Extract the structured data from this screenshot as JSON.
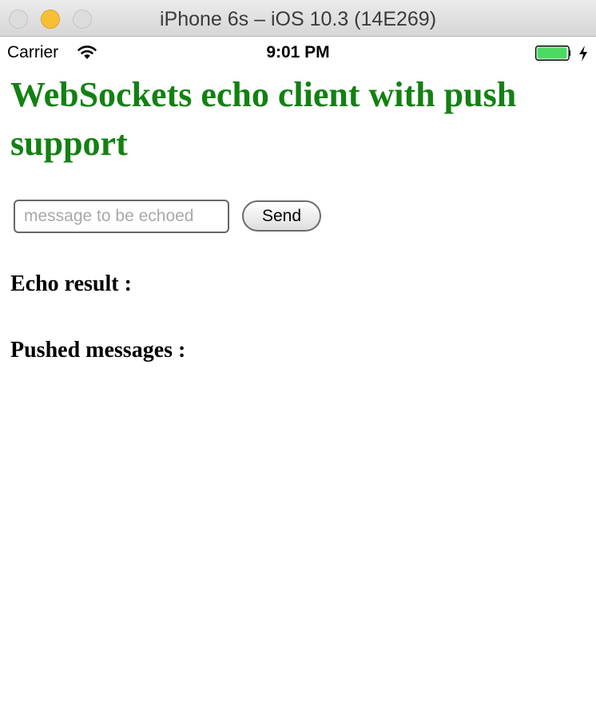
{
  "window": {
    "title": "iPhone 6s – iOS 10.3 (14E269)"
  },
  "status_bar": {
    "carrier": "Carrier",
    "time": "9:01 PM",
    "battery_level": 1.0,
    "charging": true
  },
  "page": {
    "title": "WebSockets echo client with push support",
    "message_input": {
      "value": "",
      "placeholder": "message to be echoed"
    },
    "send_label": "Send",
    "echo_result_label": "Echo result :",
    "pushed_messages_label": "Pushed messages :"
  },
  "colors": {
    "title_green": "#128112",
    "battery_green": "#4cd964"
  }
}
